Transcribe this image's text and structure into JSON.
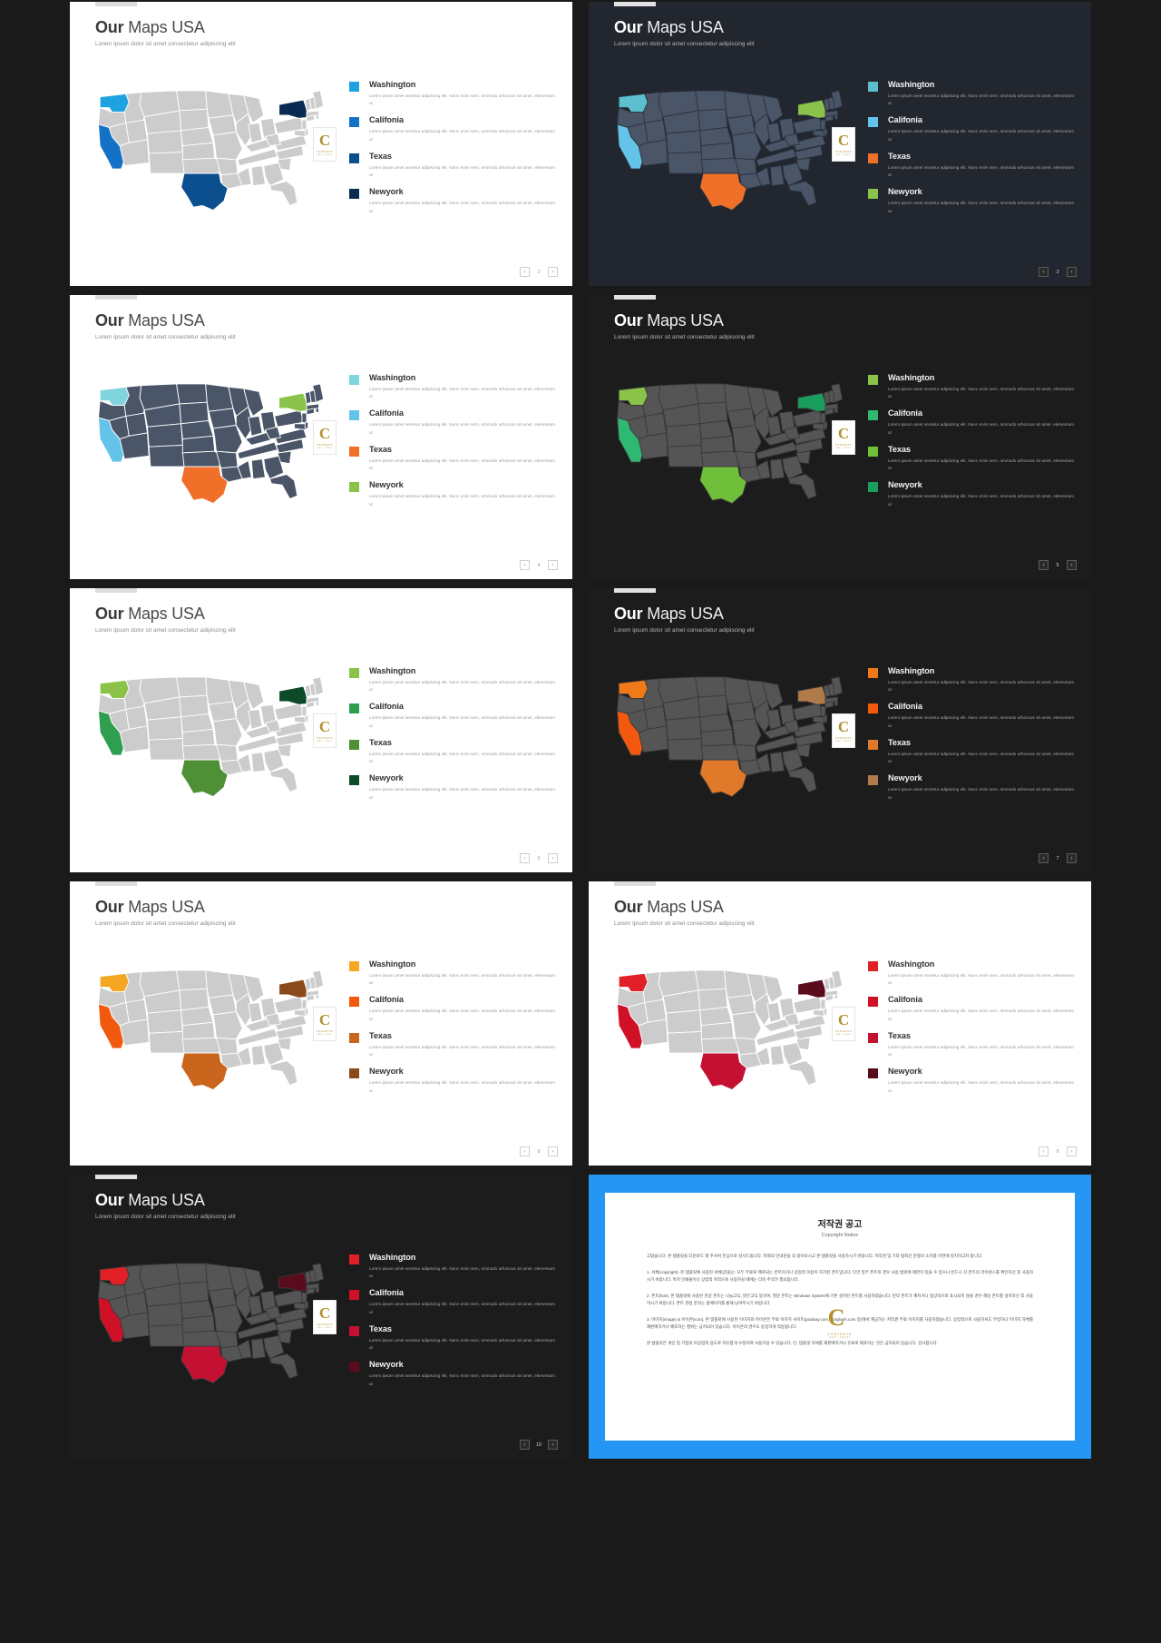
{
  "deck": {
    "title_bold": "Our",
    "title_rest": " Maps USA",
    "subtitle": "Lorem ipsum dolor sit amet consectetur adipiscing elit",
    "legend_desc_line1": "Lorem ipsum amet sectetur adipiscing elit. Nunc enim",
    "legend_desc_line2": "sem, ommodo arhoncus sit amet, elementum ut",
    "badge": {
      "letter": "C",
      "line2": "CONTENTS",
      "line3": "MAP / CHART"
    },
    "pager": {
      "prev": "‹",
      "next": "›"
    }
  },
  "legend_labels": [
    "Washington",
    "Califonia",
    "Texas",
    "Newyork"
  ],
  "slides": [
    {
      "n": 1,
      "page": "2",
      "theme": "light",
      "map_base": "#cccccc",
      "map_stroke": "#ffffff",
      "colors": [
        "#1ea2e0",
        "#1371c6",
        "#0c4f8f",
        "#0a2a52"
      ],
      "states": {
        "WA": "#1ea2e0",
        "CA": "#1371c6",
        "TX": "#0c4f8f",
        "NY": "#0a2a52"
      }
    },
    {
      "n": 2,
      "page": "3",
      "theme": "navy",
      "map_base": "#4a5568",
      "map_stroke": "#2b3340",
      "colors": [
        "#5bbfd0",
        "#63c3e8",
        "#f0702a",
        "#8bc34a"
      ],
      "states": {
        "WA": "#5bbfd0",
        "CA": "#63c3e8",
        "TX": "#f0702a",
        "NY": "#8bc34a"
      }
    },
    {
      "n": 3,
      "page": "4",
      "theme": "light",
      "map_base": "#4a5568",
      "map_stroke": "#ffffff",
      "colors": [
        "#7fd4dd",
        "#63c3e8",
        "#f0702a",
        "#8bc34a"
      ],
      "states": {
        "WA": "#7fd4dd",
        "CA": "#63c3e8",
        "TX": "#f0702a",
        "NY": "#8bc34a"
      }
    },
    {
      "n": 4,
      "page": "5",
      "theme": "dark",
      "map_base": "#555555",
      "map_stroke": "#3a3a3a",
      "colors": [
        "#8bc34a",
        "#2eb872",
        "#6fbf3a",
        "#1a9e5e"
      ],
      "states": {
        "WA": "#8bc34a",
        "CA": "#2eb872",
        "TX": "#6fbf3a",
        "NY": "#1a9e5e"
      }
    },
    {
      "n": 5,
      "page": "6",
      "theme": "light",
      "map_base": "#cccccc",
      "map_stroke": "#ffffff",
      "colors": [
        "#8bc34a",
        "#2e9e4f",
        "#4f8f35",
        "#0c4a28"
      ],
      "states": {
        "WA": "#8bc34a",
        "CA": "#2e9e4f",
        "TX": "#4f8f35",
        "NY": "#0c4a28"
      }
    },
    {
      "n": 6,
      "page": "7",
      "theme": "dark",
      "map_base": "#555555",
      "map_stroke": "#3a3a3a",
      "colors": [
        "#f07a18",
        "#f2590f",
        "#e07a2a",
        "#b07a4a"
      ],
      "states": {
        "WA": "#f07a18",
        "CA": "#f2590f",
        "TX": "#e07a2a",
        "NY": "#b07a4a"
      }
    },
    {
      "n": 7,
      "page": "8",
      "theme": "light",
      "map_base": "#cccccc",
      "map_stroke": "#ffffff",
      "colors": [
        "#f5a623",
        "#f2590f",
        "#c9651c",
        "#8a4a1a"
      ],
      "states": {
        "WA": "#f5a623",
        "CA": "#f2590f",
        "TX": "#c9651c",
        "NY": "#8a4a1a"
      }
    },
    {
      "n": 8,
      "page": "9",
      "theme": "light",
      "map_base": "#cccccc",
      "map_stroke": "#ffffff",
      "colors": [
        "#e02026",
        "#cf1026",
        "#c41133",
        "#5a0b1c"
      ],
      "states": {
        "WA": "#e02026",
        "CA": "#cf1026",
        "TX": "#c41133",
        "NY": "#5a0b1c"
      }
    },
    {
      "n": 9,
      "page": "10",
      "theme": "dark",
      "map_base": "#555555",
      "map_stroke": "#3a3a3a",
      "colors": [
        "#e02026",
        "#cf1026",
        "#c41133",
        "#5a0b1c"
      ],
      "states": {
        "WA": "#e02026",
        "CA": "#cf1026",
        "TX": "#c41133",
        "NY": "#5a0b1c"
      }
    }
  ],
  "copyright": {
    "heading": "저작권 공고",
    "subheading": "Copyright Notice",
    "intro": "고맙습니다. 본 템플릿을 다운로드 해 주셔서 진심으로 감사드립니다. 아래의 안내문을 꼭 읽어보시고 본 템플릿을 사용하시기 바랍니다. 저작권 및 기타 법적인 분쟁의 소지를 미연에 방지하고자 합니다.",
    "p1": "1. 서체(copyright). 본 템플릿에 사용된 서체(글꼴)는 모두 무료로 배포되는 폰트이거나 상업적 이용이 허가된 폰트입니다. 다만 일부 폰트의 경우 사용 범위에 제한이 있을 수 있으니 반드시 각 폰트의 라이센스를 확인하신 후 사용하시기 바랍니다. 특히 인쇄물이나 상업적 목적으로 사용하실 때에는 더욱 주의가 필요합니다.",
    "p2": "2. 폰트(font). 본 템플릿에 사용된 한글 폰트는 나눔고딕, 맑은고딕 등이며, 영문 폰트는 Windows System에 기본 설치된 폰트를 사용하였습니다. 만약 폰트가 깨지거나 정상적으로 표시되지 않을 경우 해당 폰트를 설치하신 후 사용하시기 바랍니다. 폰트 관련 문의는 홈페이지를 통해 남겨주시기 바랍니다.",
    "p3": "3. 이미지(image) & 아이콘(icon). 본 템플릿에 사용된 이미지와 아이콘은 무료 이미지 사이트(pixabay.com, unsplash.com 등)에서 제공하는 저작권 무료 이미지를 사용하였습니다. 상업적으로 사용하셔도 무방하나 이미지 자체를 재판매하거나 배포하는 행위는 금지되어 있습니다. 아이콘의 경우도 동일하게 적용됩니다.",
    "outro": "본 템플릿은 개인 및 기업의 비상업적 용도로 자유롭게 수정하여 사용하실 수 있습니다. 단, 템플릿 자체를 재판매하거나 유료로 배포하는 것은 금지되어 있습니다. 감사합니다."
  }
}
